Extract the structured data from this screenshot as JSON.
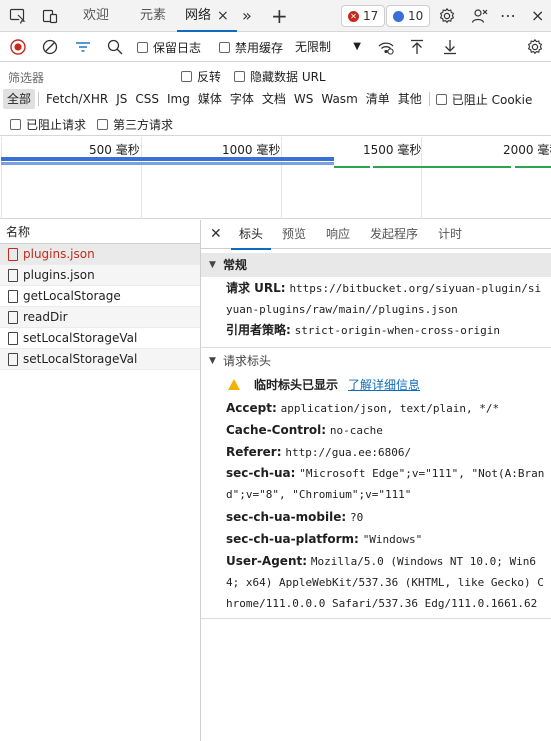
{
  "tabstrip": {
    "tabs": [
      {
        "label": "欢迎"
      },
      {
        "label": "元素"
      },
      {
        "label": "网络"
      }
    ],
    "close_glyph": "×",
    "more_glyph": "»",
    "add_glyph": "+",
    "errors_count": "17",
    "messages_count": "10",
    "menu_glyph": "⋯",
    "window_close_glyph": "×"
  },
  "toolbar": {
    "preserve_log": "保留日志",
    "disable_cache": "禁用缓存",
    "throttle": "无限制"
  },
  "filter": {
    "label": "筛选器",
    "invert": "反转",
    "hide_data_urls": "隐藏数据 URL",
    "types": [
      "全部",
      "Fetch/XHR",
      "JS",
      "CSS",
      "Img",
      "媒体",
      "字体",
      "文档",
      "WS",
      "Wasm",
      "清单",
      "其他"
    ],
    "blocked_cookies": "已阻止 Cookie",
    "blocked_requests": "已阻止请求",
    "third_party": "第三方请求"
  },
  "overview": {
    "ticks": [
      "500 毫秒",
      "1000 毫秒",
      "1500 毫秒",
      "2000 毫秒"
    ]
  },
  "requests": {
    "header": "名称",
    "items": [
      {
        "name": "plugins.json",
        "status": "error"
      },
      {
        "name": "plugins.json",
        "status": "ok"
      },
      {
        "name": "getLocalStorage",
        "status": "ok"
      },
      {
        "name": "readDir",
        "status": "ok"
      },
      {
        "name": "setLocalStorageVal",
        "status": "ok"
      },
      {
        "name": "setLocalStorageVal",
        "status": "ok"
      }
    ]
  },
  "details": {
    "tabs": [
      "标头",
      "预览",
      "响应",
      "发起程序",
      "计时"
    ],
    "general": {
      "title": "常规",
      "request_url_key": "请求 URL:",
      "request_url": "https://bitbucket.org/siyuan-plugin/siyuan-plugins/raw/main//plugins.json",
      "referrer_policy_key": "引用者策略:",
      "referrer_policy": "strict-origin-when-cross-origin"
    },
    "request_headers": {
      "title": "请求标头",
      "warning": "临时标头已显示",
      "learn_more": "了解详细信息",
      "rows": [
        {
          "key": "Accept:",
          "value": "application/json, text/plain, */*"
        },
        {
          "key": "Cache-Control:",
          "value": "no-cache"
        },
        {
          "key": "Referer:",
          "value": "http://gua.ee:6806/"
        },
        {
          "key": "sec-ch-ua:",
          "value": "\"Microsoft Edge\";v=\"111\", \"Not(A:Brand\";v=\"8\", \"Chromium\";v=\"111\""
        },
        {
          "key": "sec-ch-ua-mobile:",
          "value": "?0"
        },
        {
          "key": "sec-ch-ua-platform:",
          "value": "\"Windows\""
        },
        {
          "key": "User-Agent:",
          "value": "Mozilla/5.0 (Windows NT 10.0; Win64; x64) AppleWebKit/537.36 (KHTML, like Gecko) Chrome/111.0.0.0 Safari/537.36 Edg/111.0.1661.62"
        }
      ]
    }
  },
  "colors": {
    "accent": "#0f6cbd",
    "error": "#c42b1c",
    "timeline_blue": "#3b6fd8",
    "timeline_green": "#2ea44f",
    "warning": "#f2b200"
  }
}
